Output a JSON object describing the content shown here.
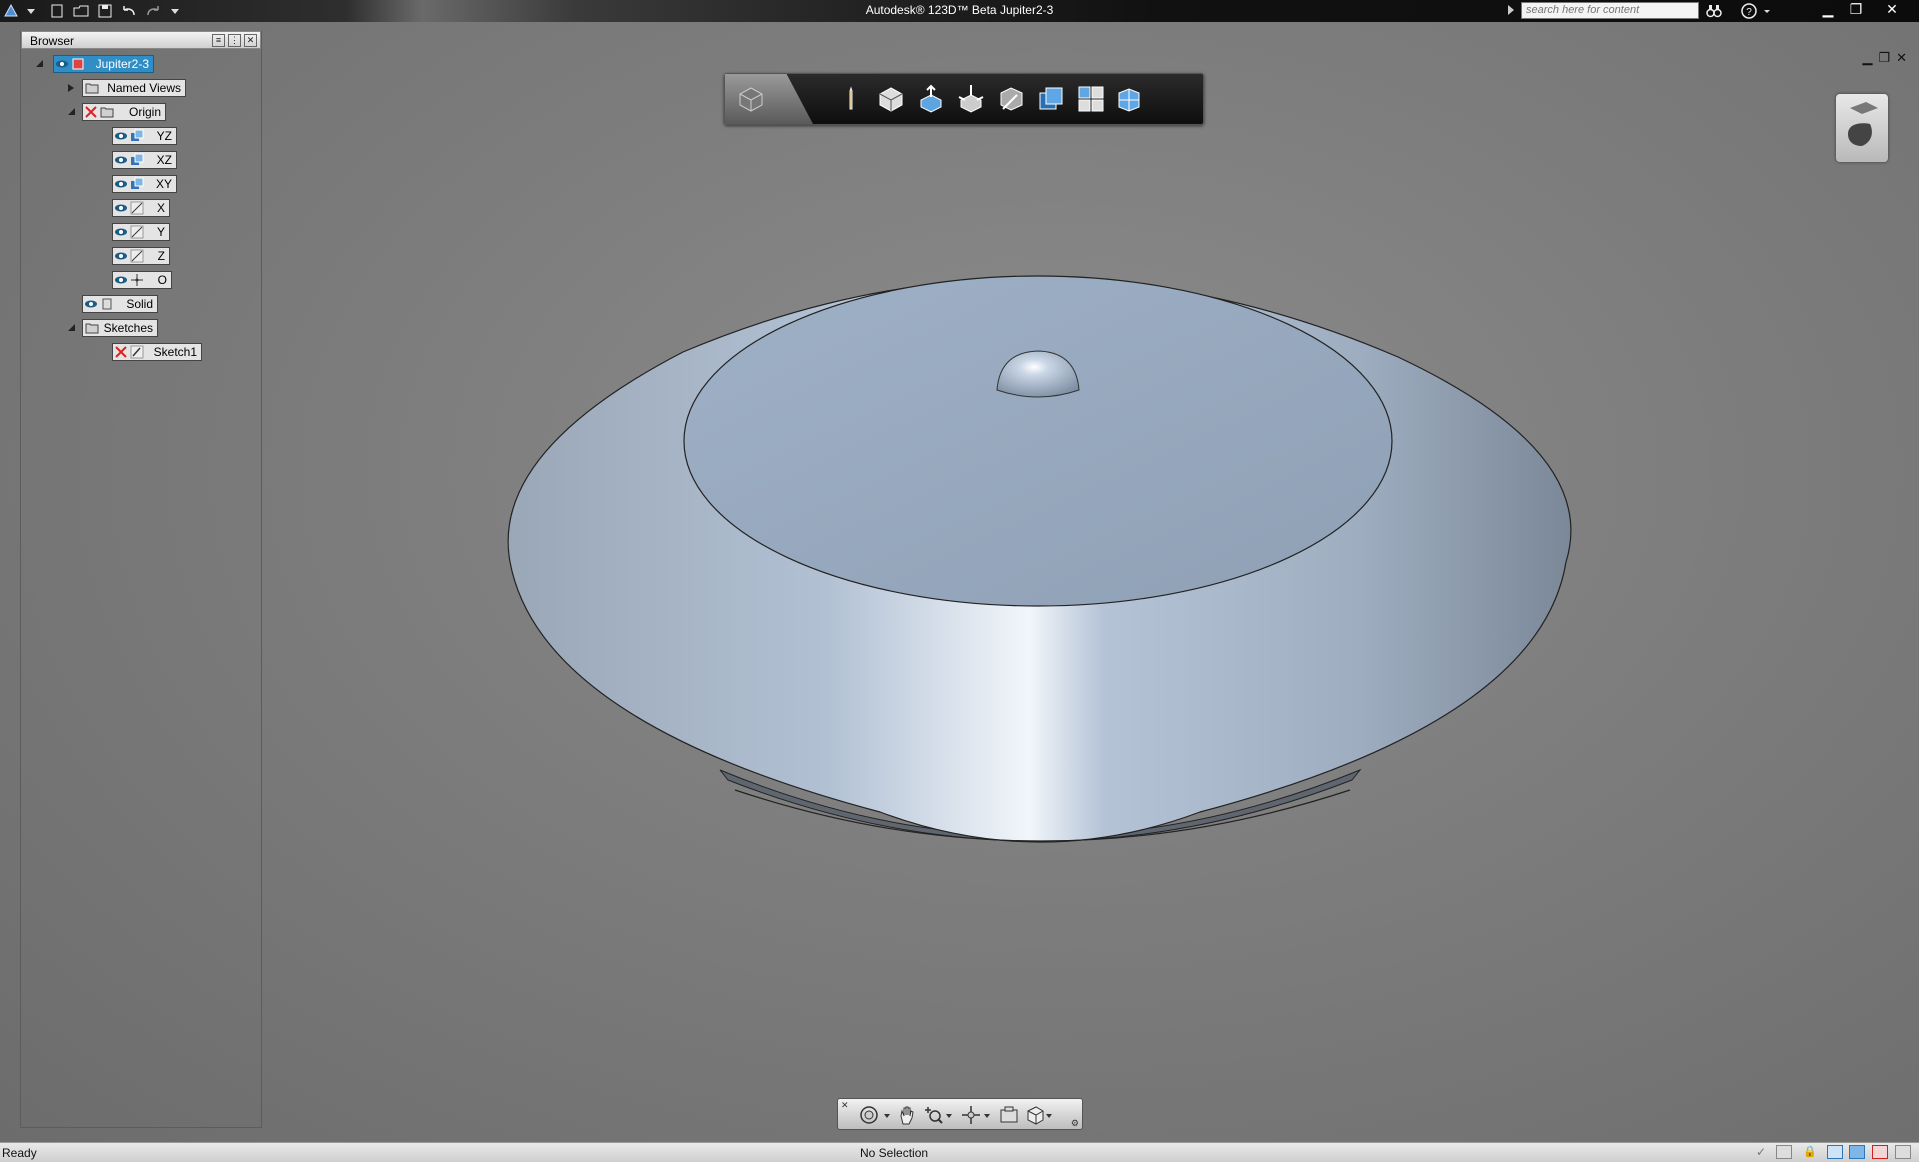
{
  "window": {
    "title": "Autodesk® 123D™ Beta    Jupiter2-3",
    "search_placeholder": "search here for content"
  },
  "quick_access": [
    "app-menu-icon",
    "new-icon",
    "open-icon",
    "save-icon",
    "undo-icon",
    "redo-icon",
    "customize-icon"
  ],
  "browser": {
    "title": "Browser",
    "root": "Jupiter2-3",
    "named_views": "Named Views",
    "origin": "Origin",
    "planes": [
      "YZ",
      "XZ",
      "XY"
    ],
    "axes": [
      "X",
      "Y",
      "Z"
    ],
    "origin_point": "O",
    "solid": "Solid",
    "sketches": "Sketches",
    "sketch1": "Sketch1"
  },
  "view_toolbar": [
    "home-view-icon",
    "sketch-icon",
    "box-icon",
    "extrude-icon",
    "move-icon",
    "measure-icon",
    "shaded-icon",
    "grid-icon",
    "cubes-icon"
  ],
  "nav_bar": [
    "orbit-icon",
    "pan-icon",
    "zoom-icon",
    "look-icon",
    "camera-icon",
    "view-cube-icon"
  ],
  "status": {
    "left": "Ready",
    "center": "No Selection"
  },
  "colors": {
    "selection": "#2f8ec6",
    "model": "#a8b8cc"
  }
}
